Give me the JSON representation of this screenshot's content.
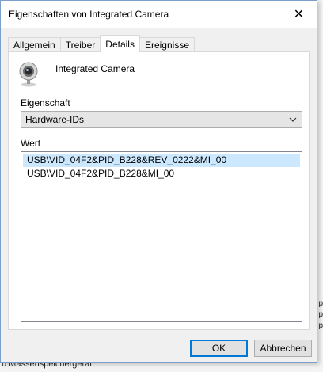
{
  "window": {
    "title": "Eigenschaften von Integrated Camera",
    "close_glyph": "✕"
  },
  "tabs": [
    {
      "label": "Allgemein",
      "active": false
    },
    {
      "label": "Treiber",
      "active": false
    },
    {
      "label": "Details",
      "active": true
    },
    {
      "label": "Ereignisse",
      "active": false
    }
  ],
  "device": {
    "name": "Integrated Camera",
    "icon": "webcam-icon"
  },
  "property": {
    "label": "Eigenschaft",
    "selected": "Hardware-IDs"
  },
  "value": {
    "label": "Wert",
    "items": [
      "USB\\VID_04F2&PID_B228&REV_0222&MI_00",
      "USB\\VID_04F2&PID_B228&MI_00"
    ],
    "selected_index": 0
  },
  "buttons": {
    "ok": "OK",
    "cancel": "Abbrechen"
  },
  "background": {
    "bottom_text": "b Massenspeichergerät",
    "right_marks": [
      "p",
      "p",
      "p"
    ]
  },
  "colors": {
    "accent": "#0078d7",
    "selection": "#cce8ff",
    "dialog_bg": "#f0f0f0"
  }
}
